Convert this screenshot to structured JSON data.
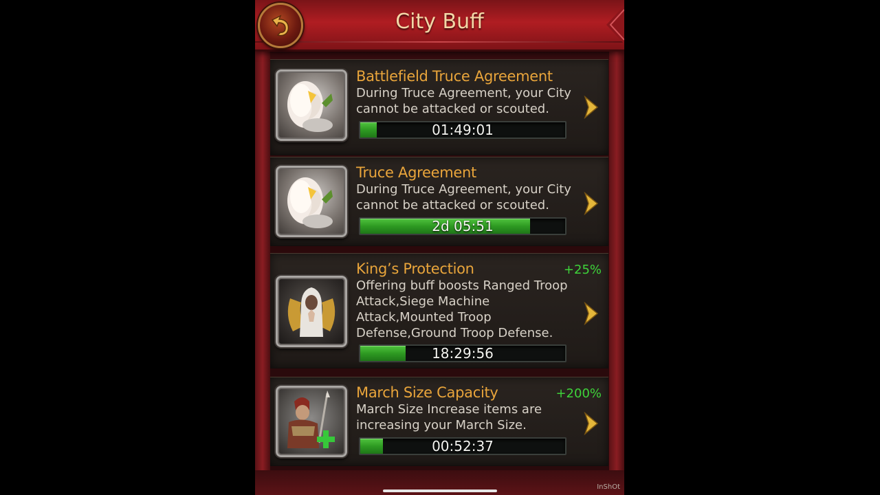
{
  "header": {
    "title": "City Buff"
  },
  "buffs": [
    {
      "title": "Battlefield Truce Agreement",
      "description": "During Truce Agreement, your City cannot be attacked or scouted.",
      "bonus": "",
      "timer": "01:49:01",
      "progress": 0.08,
      "icon": "dove-icon"
    },
    {
      "title": "Truce Agreement",
      "description": "During Truce Agreement, your City cannot be attacked or scouted.",
      "bonus": "",
      "timer": "2d 05:51",
      "progress": 0.83,
      "icon": "dove-icon"
    },
    {
      "title": "King’s Protection",
      "description": "Offering buff boosts Ranged Troop Attack,Siege Machine Attack,Mounted Troop Defense,Ground Troop Defense.",
      "bonus": "+25%",
      "timer": "18:29:56",
      "progress": 0.22,
      "icon": "praying-angel-icon"
    },
    {
      "title": "March Size Capacity",
      "description": "March Size Increase items are increasing your March Size.",
      "bonus": "+200%",
      "timer": "00:52:37",
      "progress": 0.11,
      "icon": "soldier-plus-icon"
    }
  ],
  "watermark": "InShOt",
  "colors": {
    "title": "#e9a53b",
    "bonus": "#3ed33a",
    "progress": "#3fae2f",
    "header": "#b01d22"
  }
}
